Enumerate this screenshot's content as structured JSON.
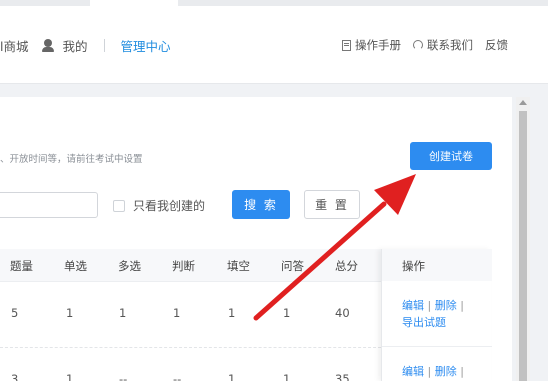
{
  "header": {
    "nav_left": [
      {
        "label": "l商城"
      },
      {
        "label": "我的"
      },
      {
        "label": "管理中心"
      }
    ],
    "nav_right": [
      {
        "label": "操作手册"
      },
      {
        "label": "联系我们"
      },
      {
        "label": "反馈"
      }
    ]
  },
  "toolbar": {
    "hint": "、开放时间等，请前往考试中设置",
    "create_button": "创建试卷",
    "only_mine_label": "只看我创建的",
    "search_button": "搜 索",
    "reset_button": "重 置"
  },
  "table": {
    "columns": [
      "题量",
      "单选",
      "多选",
      "判断",
      "填空",
      "问答",
      "总分",
      "操作"
    ],
    "rows": [
      {
        "cells": [
          "5",
          "1",
          "1",
          "1",
          "1",
          "1",
          "40"
        ],
        "actions": {
          "edit": "编辑",
          "delete": "删除",
          "export": "导出试题"
        }
      },
      {
        "cells": [
          "3",
          "1",
          "--",
          "--",
          "1",
          "1",
          "35"
        ],
        "actions": {
          "edit": "编辑",
          "delete": "删除"
        }
      }
    ]
  },
  "colors": {
    "accent": "#2d8cf0",
    "arrow": "#e02020"
  }
}
